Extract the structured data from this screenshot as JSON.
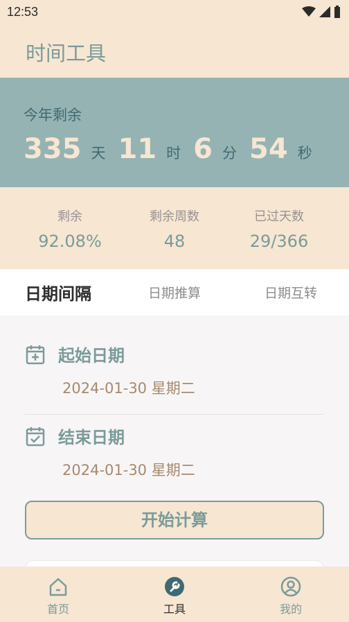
{
  "status": {
    "time": "12:53"
  },
  "header": {
    "title": "时间工具"
  },
  "countdown": {
    "label": "今年剩余",
    "days": "335",
    "days_unit": "天",
    "hours": "11",
    "hours_unit": "时",
    "minutes": "6",
    "minutes_unit": "分",
    "seconds": "54",
    "seconds_unit": "秒"
  },
  "stats": [
    {
      "label": "剩余",
      "value": "92.08%"
    },
    {
      "label": "剩余周数",
      "value": "48"
    },
    {
      "label": "已过天数",
      "value": "29/366"
    }
  ],
  "tabs": [
    {
      "label": "日期间隔",
      "active": true
    },
    {
      "label": "日期推算",
      "active": false
    },
    {
      "label": "日期互转",
      "active": false
    }
  ],
  "start_date": {
    "title": "起始日期",
    "value": "2024-01-30 星期二"
  },
  "end_date": {
    "title": "结束日期",
    "value": "2024-01-30 星期二"
  },
  "calculate_button": "开始计算",
  "nav": [
    {
      "label": "首页",
      "icon": "home-icon"
    },
    {
      "label": "工具",
      "icon": "wrench-icon",
      "active": true
    },
    {
      "label": "我的",
      "icon": "user-icon"
    }
  ],
  "colors": {
    "accent": "#7a9b9a",
    "cream": "#f6e6d2",
    "teal_panel": "#95b3b3",
    "date_text": "#a58a70"
  }
}
